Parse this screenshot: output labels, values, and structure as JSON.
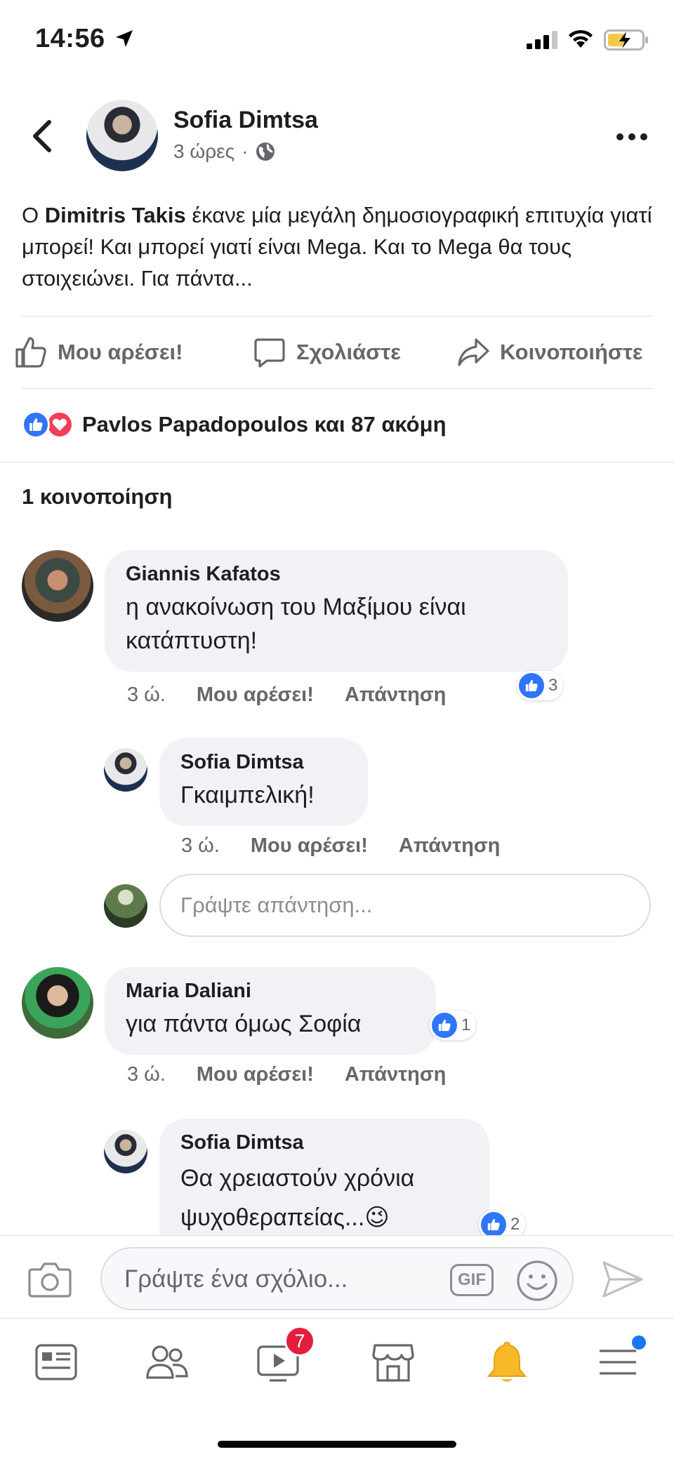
{
  "status_bar": {
    "time": "14:56"
  },
  "post": {
    "author": "Sofia Dimtsa",
    "time": "3 ώρες",
    "text_prefix": "Ο ",
    "text_bold": "Dimitris Takis",
    "text_rest": " έκανε μία μεγάλη δημοσιογραφική επιτυχία γιατί μπορεί! Και μπορεί γιατί είναι Mega. Και το Mega θα τους στοιχειώνει. Για πάντα..."
  },
  "actions": {
    "like": "Μου αρέσει!",
    "comment": "Σχολιάστε",
    "share": "Κοινοποιήστε"
  },
  "reactions": {
    "summary": "Pavlos Papadopoulos και 87 ακόμη"
  },
  "shares": "1 κοινοποίηση",
  "comments": [
    {
      "author": "Giannis Kafatos",
      "text_line1": "η ανακοίνωση του Μαξίμου είναι",
      "text_line2": "κατάπτυστη!",
      "time": "3 ώ.",
      "like": "Μου αρέσει!",
      "reply": "Απάντηση",
      "likes": "3"
    },
    {
      "author": "Sofia Dimtsa",
      "text": "Γκαιμπελική!",
      "time": "3 ώ.",
      "like": "Μου αρέσει!",
      "reply": "Απάντηση"
    },
    {
      "author": "Maria Daliani",
      "text": "για πάντα όμως Σοφία",
      "time": "3 ώ.",
      "like": "Μου αρέσει!",
      "reply": "Απάντηση",
      "likes": "1"
    },
    {
      "author": "Sofia Dimtsa",
      "text_line1": "Θα χρειαστούν χρόνια",
      "text_line2": "ψυχοθεραπείας...😉",
      "likes": "2"
    }
  ],
  "reply_input": {
    "placeholder": "Γράψτε απάντηση..."
  },
  "composer": {
    "placeholder": "Γράψτε ένα σχόλιο...",
    "gif": "GIF"
  },
  "tabbar": {
    "video_badge": "7"
  },
  "colors": {
    "accent": "#1877f2",
    "like_blue": "#2e76f7",
    "love_red": "#f33e58",
    "badge_red": "#e41e3f",
    "muted": "#65676b"
  }
}
